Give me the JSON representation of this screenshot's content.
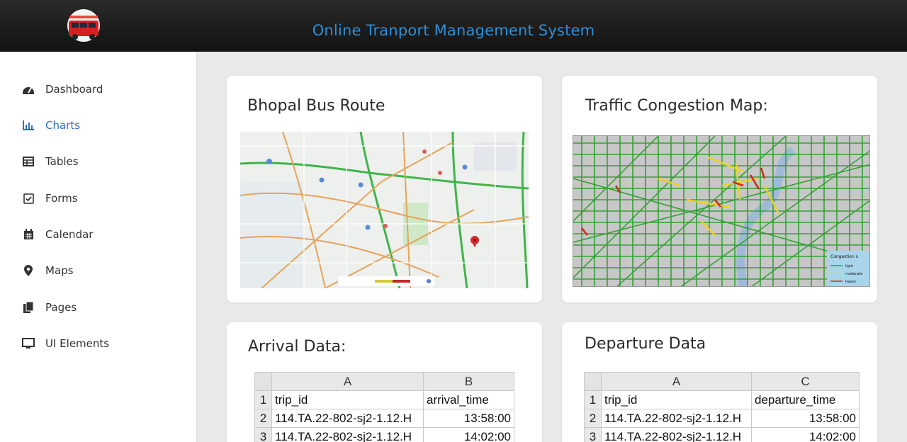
{
  "header": {
    "title": "Online Tranport Management System"
  },
  "sidebar": {
    "items": [
      {
        "label": "Dashboard",
        "icon": "tachometer-icon"
      },
      {
        "label": "Charts",
        "icon": "bar-chart-icon",
        "active": true
      },
      {
        "label": "Tables",
        "icon": "table-icon"
      },
      {
        "label": "Forms",
        "icon": "checkbox-icon"
      },
      {
        "label": "Calendar",
        "icon": "calendar-icon"
      },
      {
        "label": "Maps",
        "icon": "map-marker-icon"
      },
      {
        "label": "Pages",
        "icon": "copy-icon"
      },
      {
        "label": "UI Elements",
        "icon": "monitor-icon"
      }
    ]
  },
  "cards": {
    "bus_route": {
      "title": "Bhopal Bus Route"
    },
    "traffic": {
      "title": "Traffic Congestion Map:",
      "legend": {
        "title": "Congestion s",
        "items": [
          "light",
          "moderate",
          "heavy"
        ]
      }
    },
    "arrival": {
      "title": "Arrival Data:",
      "col_letters": [
        "A",
        "B"
      ],
      "headers": [
        "trip_id",
        "arrival_time"
      ],
      "row_numbers": [
        "1",
        "2",
        "3"
      ],
      "rows": [
        [
          "114.TA.22-802-sj2-1.12.H",
          "13:58:00"
        ],
        [
          "114.TA.22-802-sj2-1.12.H",
          "14:02:00"
        ]
      ]
    },
    "departure": {
      "title": "Departure Data",
      "col_letters": [
        "A",
        "C"
      ],
      "headers": [
        "trip_id",
        "departure_time"
      ],
      "row_numbers": [
        "1",
        "2",
        "3"
      ],
      "rows": [
        [
          "114.TA.22-802-sj2-1.12.H",
          "13:58:00"
        ],
        [
          "114.TA.22-802-sj2-1.12.H",
          "14:02:00"
        ]
      ]
    }
  },
  "colors": {
    "accent": "#2f8ed6",
    "active_nav": "#2f6fc7",
    "light": "#2e9e2e",
    "moderate": "#f1d21b",
    "heavy": "#d62424"
  }
}
